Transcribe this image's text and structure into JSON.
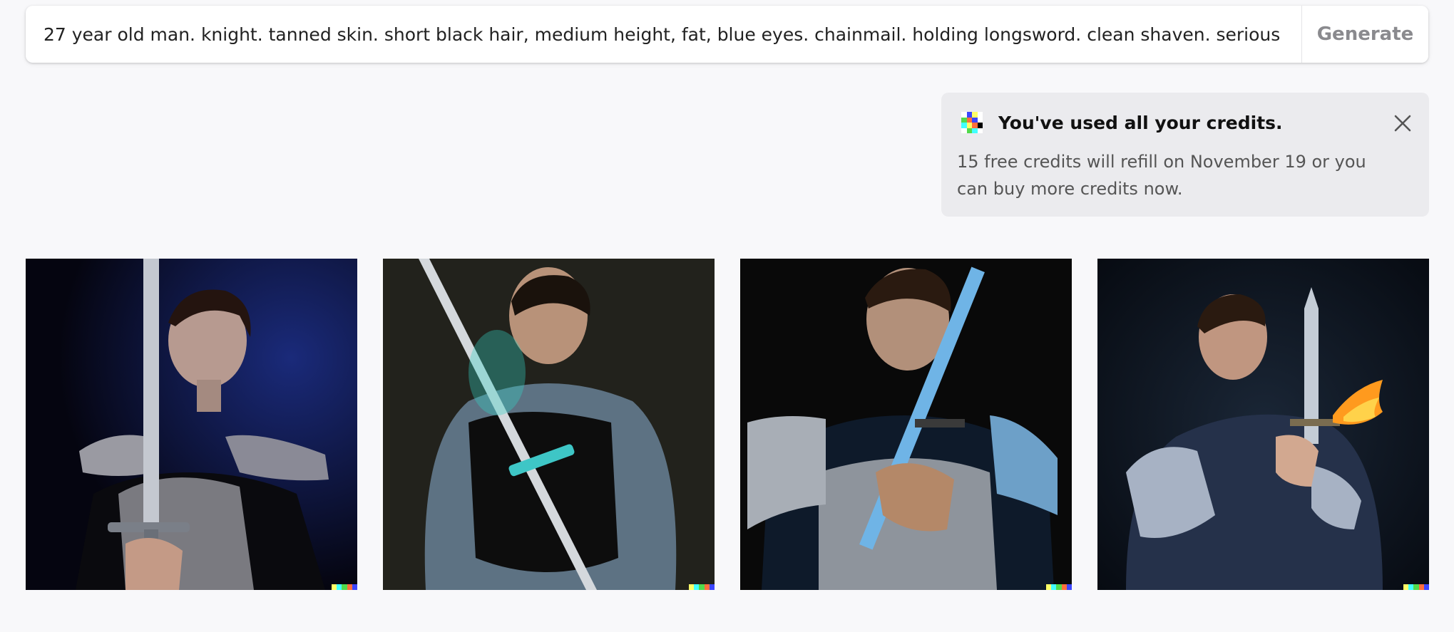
{
  "prompt": {
    "value": "27 year old man. knight. tanned skin. short black hair, medium height, fat, blue eyes. chainmail. holding longsword. clean shaven. serious exp"
  },
  "generate_button": {
    "label": "Generate"
  },
  "credits_notice": {
    "title": "You've used all your credits.",
    "body": "15 free credits will refill on November 19 or you can buy more credits now.",
    "close_icon": "close-icon"
  },
  "colors": {
    "page_bg": "#f8f8fa",
    "notice_bg": "#ebebee",
    "generate_text": "#8a8a8e",
    "logo_colors": [
      "#ffff66",
      "#42ffff",
      "#51da4c",
      "#ff6e3c",
      "#3c46ff"
    ]
  },
  "images": [
    {
      "subject": "knight-holding-sword-vertical",
      "background": "#0b0b1a"
    },
    {
      "subject": "knight-with-shield-and-sword",
      "background": "#1a1a16"
    },
    {
      "subject": "knight-in-plate-armor-with-sword",
      "background": "#0a0a0a"
    },
    {
      "subject": "knight-with-sword-and-fire",
      "background": "#0d1520"
    }
  ]
}
